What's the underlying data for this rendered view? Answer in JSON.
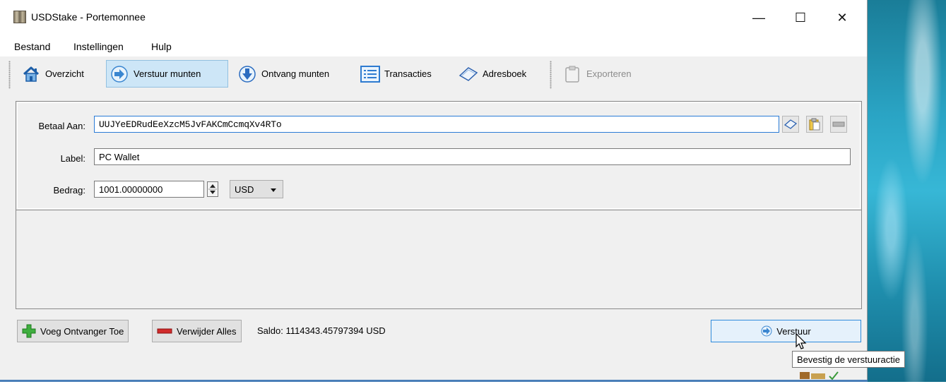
{
  "window": {
    "title": "USDStake - Portemonnee",
    "controls": {
      "minimize": "—",
      "maximize": "☐",
      "close": "✕"
    }
  },
  "menu": [
    "Bestand",
    "Instellingen",
    "Hulp"
  ],
  "toolbar": {
    "overview": "Overzicht",
    "send": "Verstuur munten",
    "receive": "Ontvang munten",
    "transactions": "Transacties",
    "addressbook": "Adresboek",
    "export": "Exporteren"
  },
  "form": {
    "pay_to_label": "Betaal Aan:",
    "pay_to_value": "UUJYeEDRudEeXzcM5JvFAKCmCcmqXv4RTo",
    "label_label": "Label:",
    "label_value": "PC Wallet",
    "amount_label": "Bedrag:",
    "amount_value": "1001.00000000",
    "unit": "USD"
  },
  "footer": {
    "add_recipient": "Voeg Ontvanger Toe",
    "clear_all": "Verwijder Alles",
    "balance": "Saldo: 1114343.45797394 USD",
    "send_button": "Verstuur",
    "tooltip": "Bevestig de verstuuractie"
  },
  "colors": {
    "accent_blue": "#2e8bdc",
    "active_toolbar_bg": "#cde6f7",
    "window_bg": "#f0f0f0"
  }
}
